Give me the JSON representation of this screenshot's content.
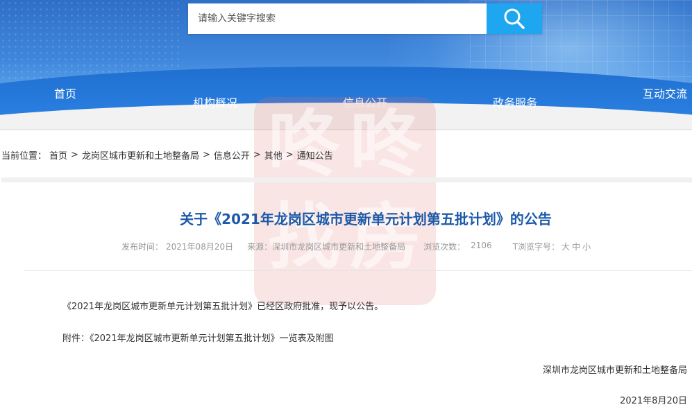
{
  "search": {
    "placeholder": "请输入关键字搜索",
    "button_icon": "search-icon"
  },
  "nav": {
    "items": [
      {
        "label": "首页"
      },
      {
        "label": "机构概况"
      },
      {
        "label": "信息公开"
      },
      {
        "label": "政务服务"
      },
      {
        "label": "互动交流"
      }
    ]
  },
  "breadcrumb": {
    "prefix": "当前位置：",
    "items": [
      {
        "label": "首页"
      },
      {
        "label": "龙岗区城市更新和土地整备局"
      },
      {
        "label": "信息公开"
      },
      {
        "label": "其他"
      },
      {
        "label": "通知公告"
      }
    ],
    "separator": ">"
  },
  "article": {
    "title": "关于《2021年龙岗区城市更新单元计划第五批计划》的公告",
    "meta": {
      "publish_label": "发布时间：",
      "publish_date": "2021年08月20日",
      "source_label": "来源：",
      "source": "深圳市龙岗区城市更新和土地整备局",
      "views_label": "浏览次数：",
      "views": "2106",
      "font_size_label": "T浏览字号：",
      "font_size_options": [
        "大",
        "中",
        "小"
      ]
    },
    "paragraph1": "《2021年龙岗区城市更新单元计划第五批计划》已经区政府批准，现予以公告。",
    "attachment_label": "附件：",
    "attachment_link": "《2021年龙岗区城市更新单元计划第五批计划》一览表及附图",
    "signature_org": "深圳市龙岗区城市更新和土地整备局",
    "signature_date": "2021年8月20日"
  },
  "watermark": {
    "chars": [
      "咚",
      "咚",
      "找",
      "房"
    ]
  },
  "colors": {
    "title_blue": "#1c5aa8",
    "search_button": "#1ea7f0",
    "nav_band": "#2a7fe0",
    "meta_gray": "#999999"
  }
}
